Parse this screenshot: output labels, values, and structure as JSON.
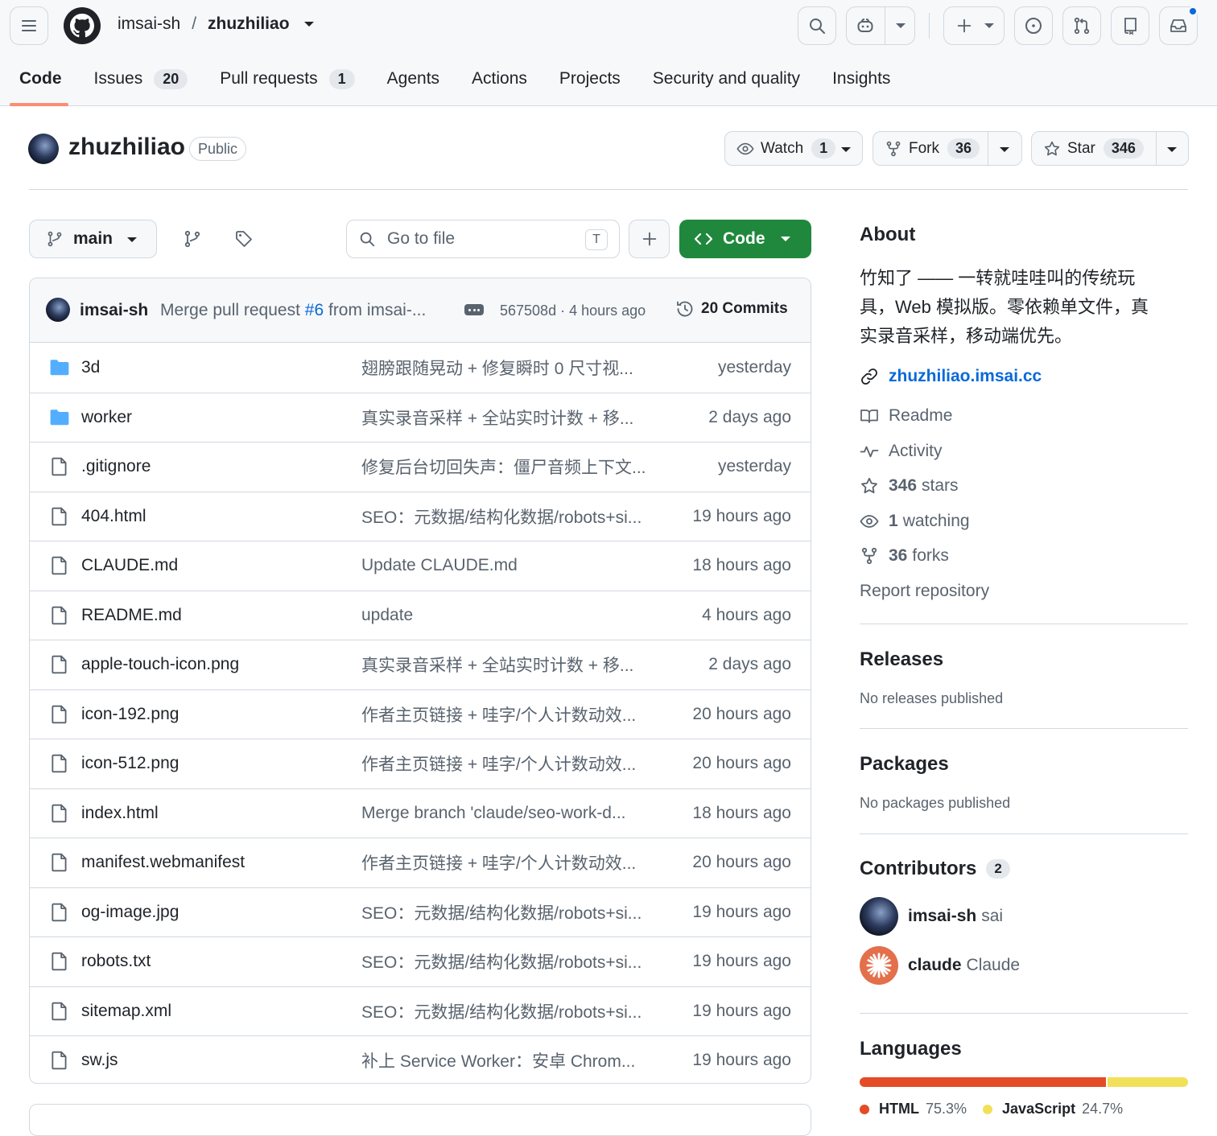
{
  "header": {
    "owner": "imsai-sh",
    "separator": "/",
    "repo": "zhuzhiliao"
  },
  "tabs": [
    {
      "label": "Code",
      "count": null
    },
    {
      "label": "Issues",
      "count": "20"
    },
    {
      "label": "Pull requests",
      "count": "1"
    },
    {
      "label": "Agents",
      "count": null
    },
    {
      "label": "Actions",
      "count": null
    },
    {
      "label": "Projects",
      "count": null
    },
    {
      "label": "Security and quality",
      "count": null
    },
    {
      "label": "Insights",
      "count": null
    }
  ],
  "repo": {
    "name": "zhuzhiliao",
    "visibility": "Public",
    "watch_label": "Watch",
    "watch_count": "1",
    "fork_label": "Fork",
    "fork_count": "36",
    "star_label": "Star",
    "star_count": "346"
  },
  "toolbar": {
    "branch": "main",
    "search_placeholder": "Go to file",
    "search_shortcut": "T",
    "code_label": "Code"
  },
  "commit": {
    "author": "imsai-sh",
    "message_prefix": "Merge pull request",
    "pr_link": "#6",
    "message_suffix": "from imsai-...",
    "sha_time": "567508d · 4 hours ago",
    "commits_label": "20 Commits"
  },
  "files": [
    {
      "name": "3d",
      "type": "folder",
      "message": "翅膀跟随晃动 + 修复瞬时 0 尺寸视...",
      "time": "yesterday"
    },
    {
      "name": "worker",
      "type": "folder",
      "message": "真实录音采样 + 全站实时计数 + 移...",
      "time": "2 days ago"
    },
    {
      "name": ".gitignore",
      "type": "file",
      "message": "修复后台切回失声：僵尸音频上下文...",
      "time": "yesterday"
    },
    {
      "name": "404.html",
      "type": "file",
      "message": "SEO：元数据/结构化数据/robots+si...",
      "time": "19 hours ago"
    },
    {
      "name": "CLAUDE.md",
      "type": "file",
      "message": "Update CLAUDE.md",
      "time": "18 hours ago"
    },
    {
      "name": "README.md",
      "type": "file",
      "message": "update",
      "time": "4 hours ago"
    },
    {
      "name": "apple-touch-icon.png",
      "type": "file",
      "message": "真实录音采样 + 全站实时计数 + 移...",
      "time": "2 days ago"
    },
    {
      "name": "icon-192.png",
      "type": "file",
      "message": "作者主页链接 + 哇字/个人计数动效...",
      "time": "20 hours ago"
    },
    {
      "name": "icon-512.png",
      "type": "file",
      "message": "作者主页链接 + 哇字/个人计数动效...",
      "time": "20 hours ago"
    },
    {
      "name": "index.html",
      "type": "file",
      "message": "Merge branch 'claude/seo-work-d...",
      "time": "18 hours ago"
    },
    {
      "name": "manifest.webmanifest",
      "type": "file",
      "message": "作者主页链接 + 哇字/个人计数动效...",
      "time": "20 hours ago"
    },
    {
      "name": "og-image.jpg",
      "type": "file",
      "message": "SEO：元数据/结构化数据/robots+si...",
      "time": "19 hours ago"
    },
    {
      "name": "robots.txt",
      "type": "file",
      "message": "SEO：元数据/结构化数据/robots+si...",
      "time": "19 hours ago"
    },
    {
      "name": "sitemap.xml",
      "type": "file",
      "message": "SEO：元数据/结构化数据/robots+si...",
      "time": "19 hours ago"
    },
    {
      "name": "sw.js",
      "type": "file",
      "message": "补上 Service Worker：安卓 Chrom...",
      "time": "19 hours ago"
    }
  ],
  "about": {
    "heading": "About",
    "description_lines": [
      "竹知了 —— 一转就哇哇叫的传统玩",
      "具，Web 模拟版。零依赖单文件，真",
      "实录音采样，移动端优先。"
    ],
    "website": "zhuzhiliao.imsai.cc",
    "readme": "Readme",
    "activity": "Activity",
    "stars_num": "346",
    "stars_word": "stars",
    "watching_num": "1",
    "watching_word": "watching",
    "forks_num": "36",
    "forks_word": "forks",
    "report": "Report repository"
  },
  "releases": {
    "heading": "Releases",
    "empty": "No releases published"
  },
  "packages": {
    "heading": "Packages",
    "empty": "No packages published"
  },
  "contributors": {
    "heading": "Contributors",
    "count": "2",
    "list": [
      {
        "login": "imsai-sh",
        "name": "sai"
      },
      {
        "login": "claude",
        "name": "Claude"
      }
    ]
  },
  "languages": {
    "heading": "Languages",
    "items": [
      {
        "name": "HTML",
        "percent": "75.3%",
        "value": 75.3,
        "color": "#e34c26"
      },
      {
        "name": "JavaScript",
        "percent": "24.7%",
        "value": 24.7,
        "color": "#f1e05a"
      }
    ]
  },
  "colors": {
    "accent_link": "#0969da",
    "code_button": "#1f883d",
    "tab_underline": "#fd8c73",
    "folder": "#54aeff",
    "notification_dot": "#0969da"
  }
}
